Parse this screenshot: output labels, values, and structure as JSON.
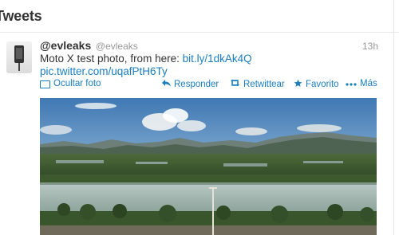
{
  "header": {
    "title": "Tweets"
  },
  "tweet": {
    "display_name": "@evleaks",
    "handle": "@evleaks",
    "time": "13h",
    "text_prefix": "Moto X test photo, from here: ",
    "link_1": "bit.ly/1dkAk4Q",
    "link_2": "pic.twitter.com/uqafPtH6Ty"
  },
  "actions": {
    "hide_photo": "Ocultar foto",
    "reply": "Responder",
    "retweet": "Retwittear",
    "favorite": "Favorito",
    "more": "Más"
  },
  "icons": {
    "avatar": "phone-avatar",
    "hide_photo": "photo-icon",
    "reply": "reply-arrow-icon",
    "retweet": "retweet-icon",
    "favorite": "star-icon",
    "more": "ellipsis-icon"
  },
  "colors": {
    "link": "#1a7fc1",
    "muted": "#999999",
    "text": "#333333"
  }
}
